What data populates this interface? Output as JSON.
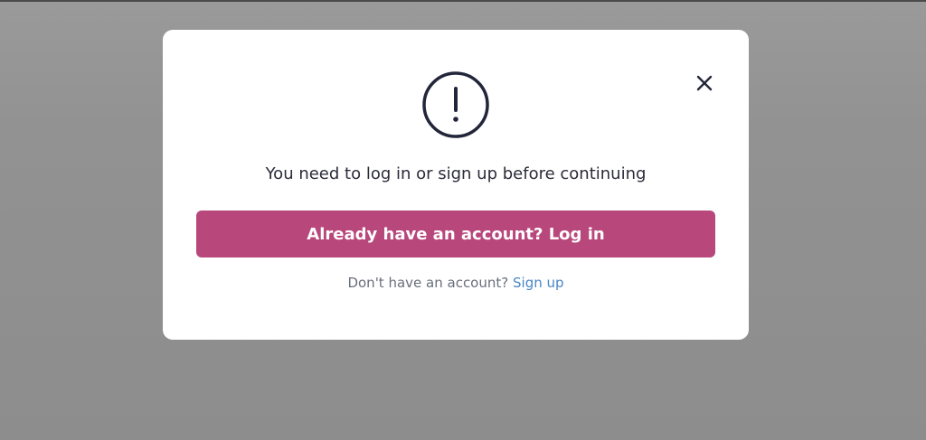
{
  "modal": {
    "message": "You need to log in or sign up before continuing",
    "login_button_label": "Already have an account? Log in",
    "signup_prompt": "Don't have an account?",
    "signup_link_label": "Sign up",
    "icons": {
      "warning": "exclamation-circle-icon",
      "close": "close-icon"
    }
  },
  "colors": {
    "backdrop": "#8c8c8c",
    "modal_background": "#ffffff",
    "primary_button": "#b8477c",
    "link": "#4a86c8",
    "text": "#2b2b3a",
    "muted_text": "#6a6f7d"
  }
}
